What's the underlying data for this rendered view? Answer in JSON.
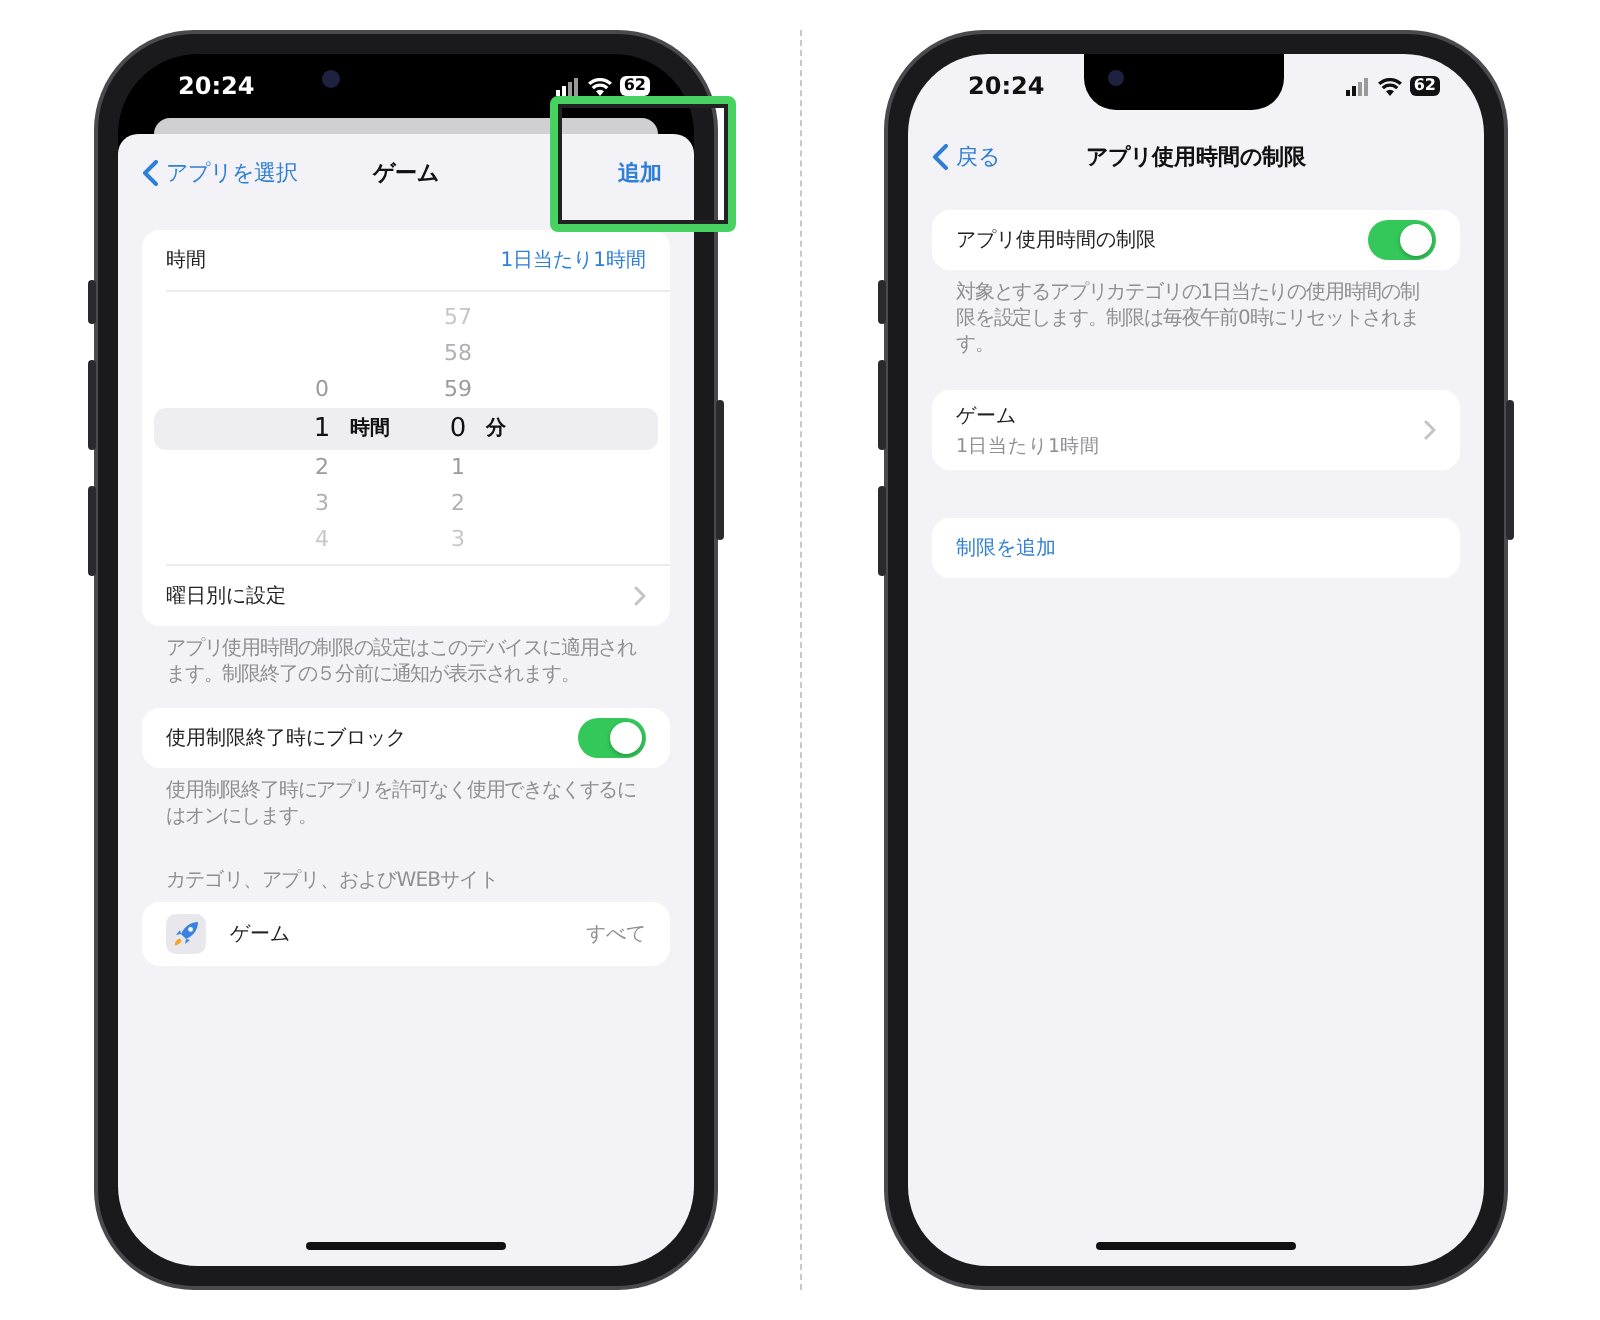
{
  "left_screen": {
    "status_bar": {
      "time": "20:24",
      "battery": "62"
    },
    "nav": {
      "back": "アプリを選択",
      "title": "ゲーム",
      "action": "追加",
      "action_highlighted": true
    },
    "time_row": {
      "label": "時間",
      "value": "1日当たり1時間"
    },
    "picker": {
      "columns": [
        {
          "unit": "時間",
          "items": [
            {
              "label": "0",
              "selected": false
            },
            {
              "label": "1",
              "selected": true
            },
            {
              "label": "2",
              "selected": false
            },
            {
              "label": "3",
              "selected": false
            },
            {
              "label": "4",
              "selected": false
            }
          ]
        },
        {
          "unit": "分",
          "items": [
            {
              "label": "57",
              "selected": false
            },
            {
              "label": "58",
              "selected": false
            },
            {
              "label": "59",
              "selected": false
            },
            {
              "label": "0",
              "selected": true
            },
            {
              "label": "1",
              "selected": false
            },
            {
              "label": "2",
              "selected": false
            },
            {
              "label": "3",
              "selected": false
            }
          ]
        }
      ]
    },
    "schedule_row": {
      "label": "曜日別に設定"
    },
    "footer_1": "アプリ使用時間の制限の設定はこのデバイスに適用されます。制限終了の５分前に通知が表示されます。",
    "block_toggle": {
      "label": "使用制限終了時にブロック",
      "on": true
    },
    "footer_2": "使用制限終了時にアプリを許可なく使用できなくするにはオンにします。",
    "section_header": "カテゴリ、アプリ、およびWEBサイト",
    "app_row": {
      "name": "ゲーム",
      "value": "すべて"
    }
  },
  "right_screen": {
    "status_bar": {
      "time": "20:24",
      "battery": "62"
    },
    "nav": {
      "back": "戻る",
      "title": "アプリ使用時間の制限"
    },
    "limit_toggle": {
      "label": "アプリ使用時間の制限",
      "on": true
    },
    "footer": "対象とするアプリカテゴリの1日当たりの使用時間の制限を設定します。制限は毎夜午前0時にリセットされます。",
    "limit_row": {
      "title": "ゲーム",
      "subtitle": "1日当たり1時間"
    },
    "add_limit": "制限を追加"
  }
}
